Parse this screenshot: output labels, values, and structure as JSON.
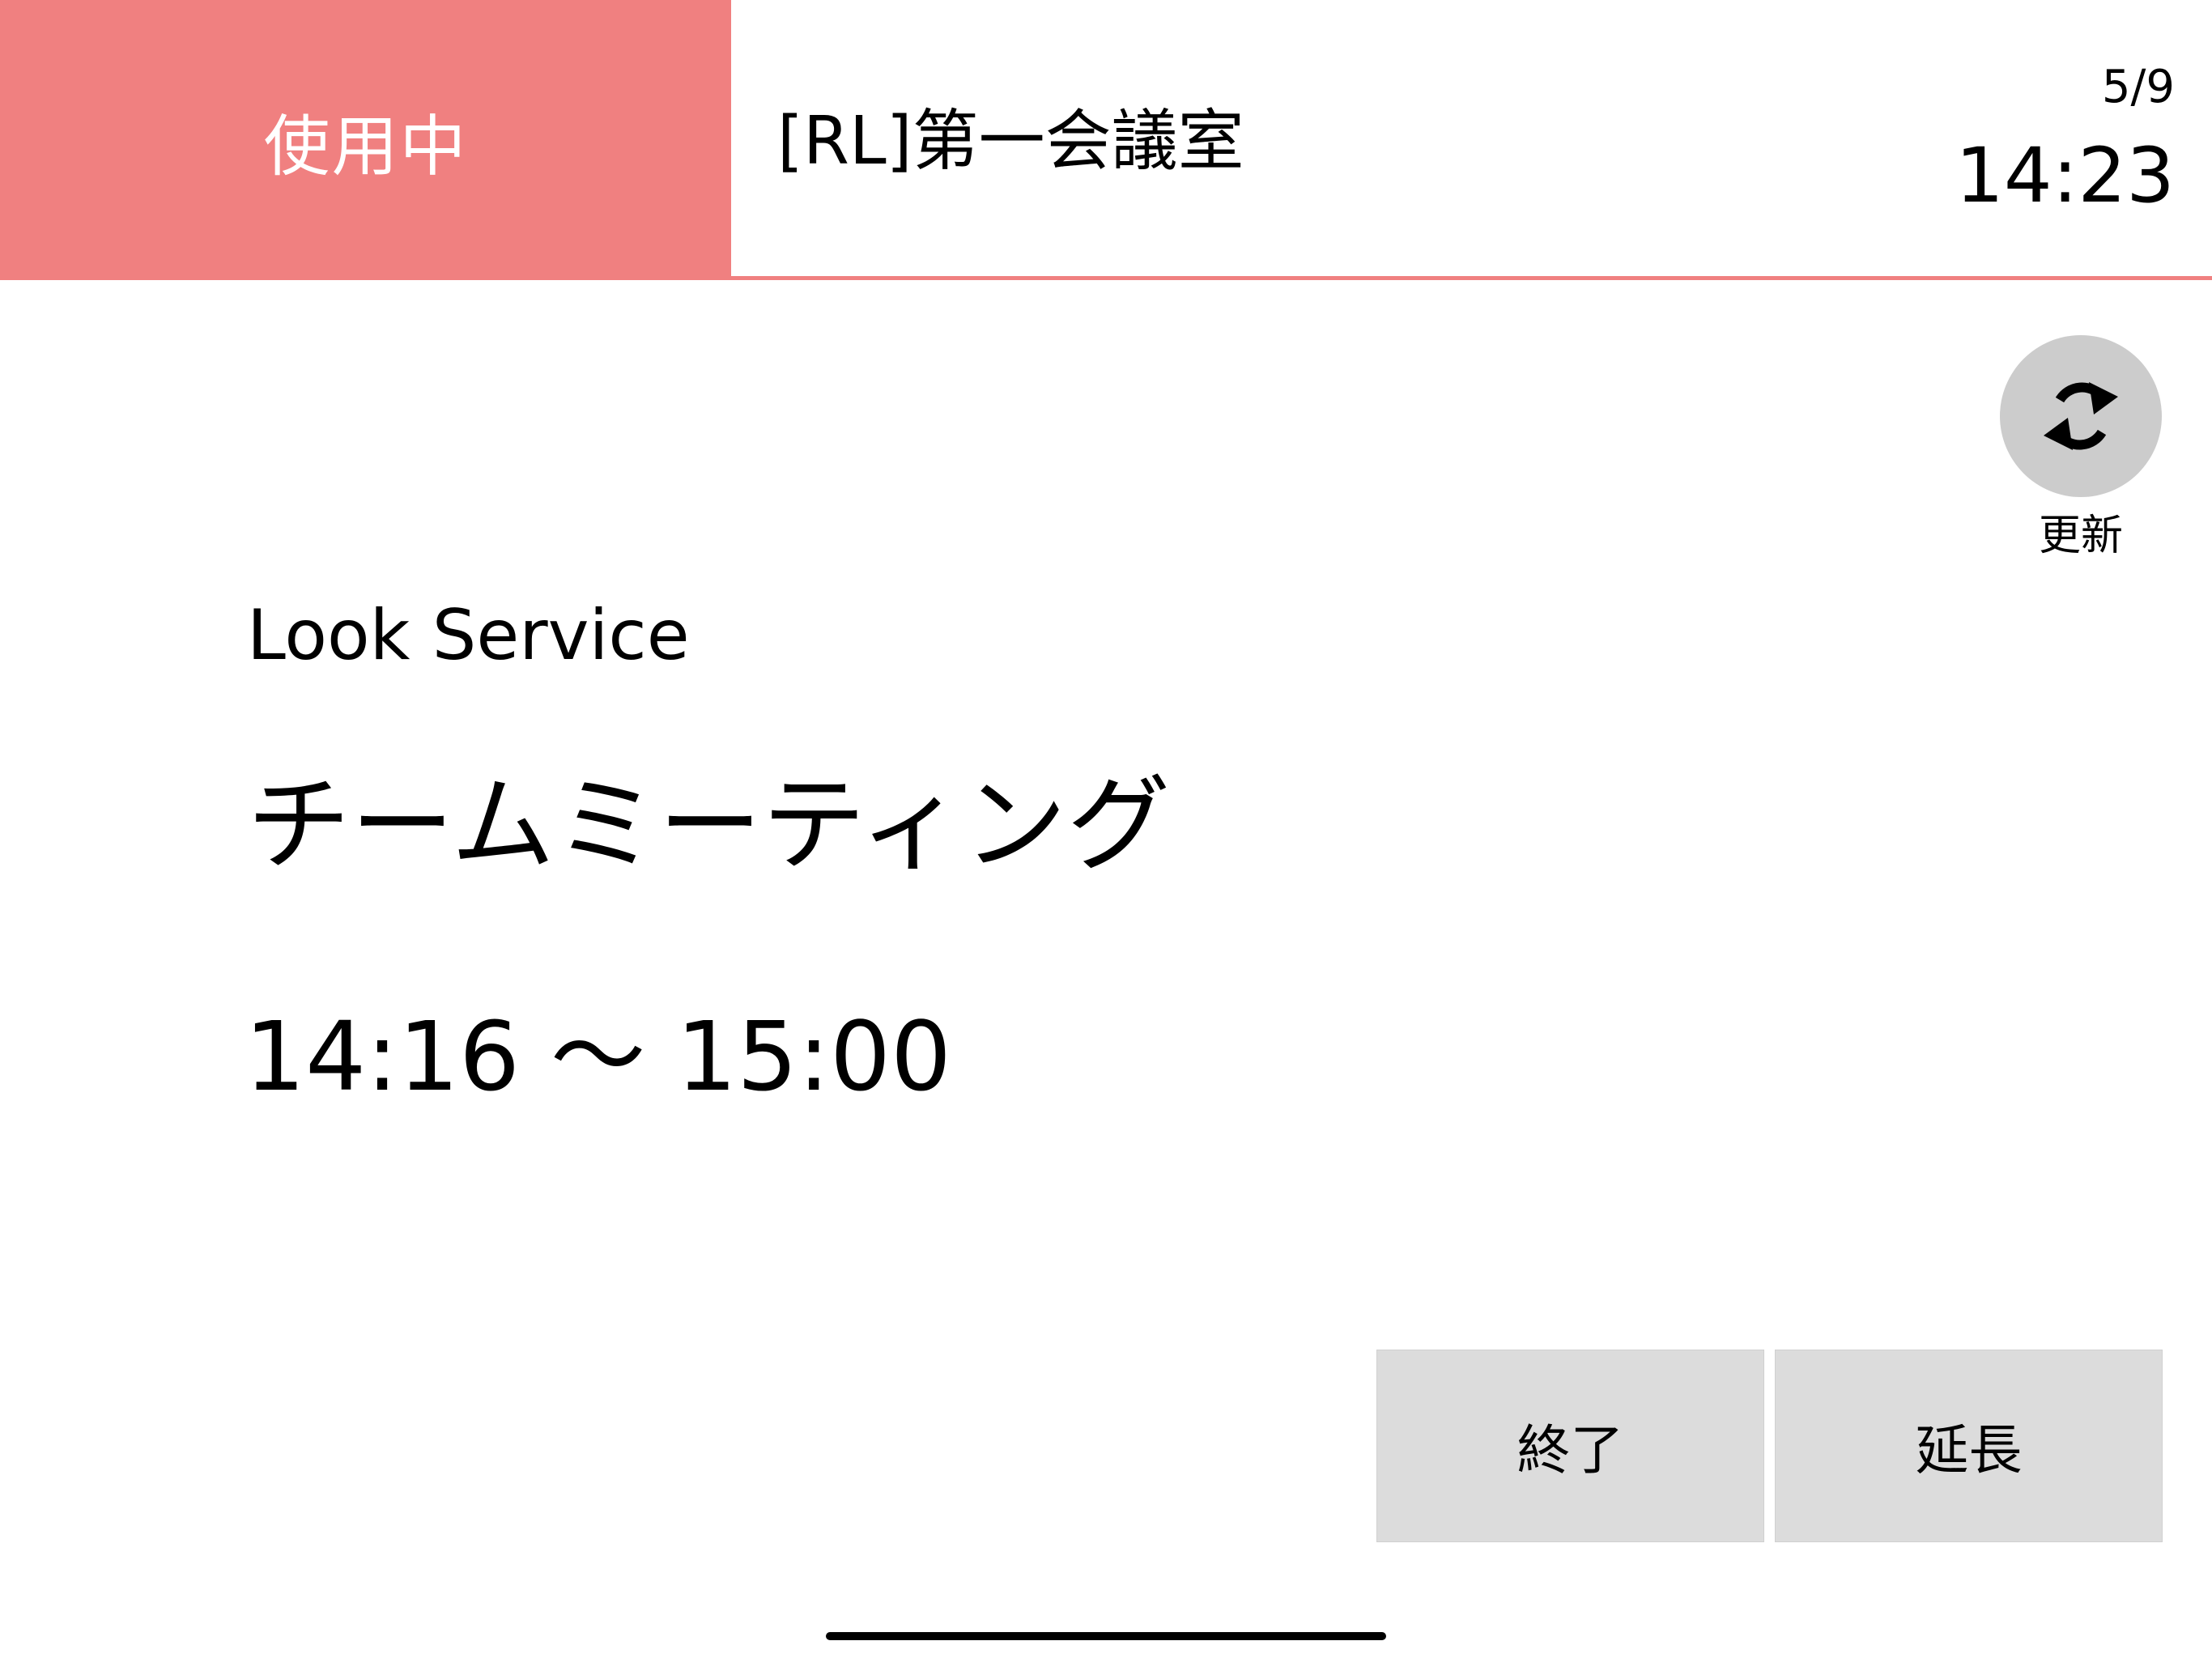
{
  "header": {
    "status": "使用中",
    "room_name": "[RL]第一会議室",
    "date": "5/9",
    "time": "14:23"
  },
  "refresh": {
    "icon": "refresh-icon",
    "label": "更新"
  },
  "meeting": {
    "organizer": "Look Service",
    "title": "チームミーティング",
    "time_range": "14:16 〜 15:00"
  },
  "actions": {
    "end_label": "終了",
    "extend_label": "延長"
  },
  "colors": {
    "status_accent": "#f08080",
    "button_bg": "#dcdcdc",
    "refresh_bg": "#cccccc"
  }
}
